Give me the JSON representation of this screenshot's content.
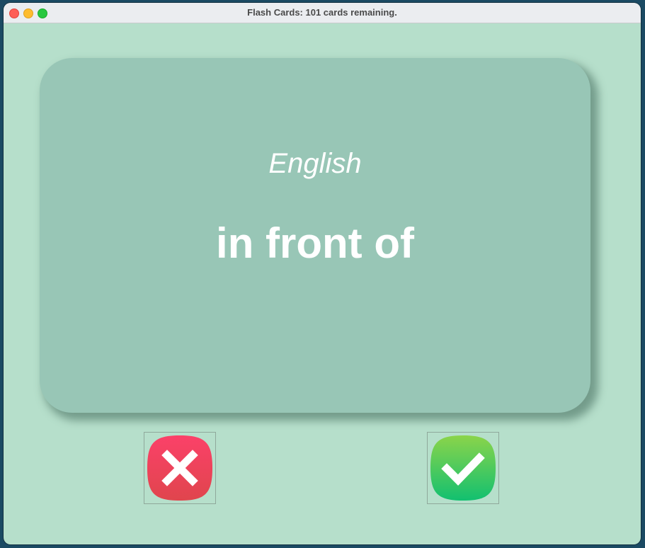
{
  "window": {
    "title": "Flash Cards: 101 cards remaining."
  },
  "card": {
    "language": "English",
    "word": "in front of"
  },
  "buttons": {
    "wrong_icon": "x-mark-icon",
    "right_icon": "checkmark-icon"
  },
  "colors": {
    "background": "#b6dfcb",
    "card": "#98c6b6",
    "wrong_top": "#fb4169",
    "wrong_bottom": "#e0454d",
    "right_top": "#8bd44a",
    "right_bottom": "#12c070"
  }
}
